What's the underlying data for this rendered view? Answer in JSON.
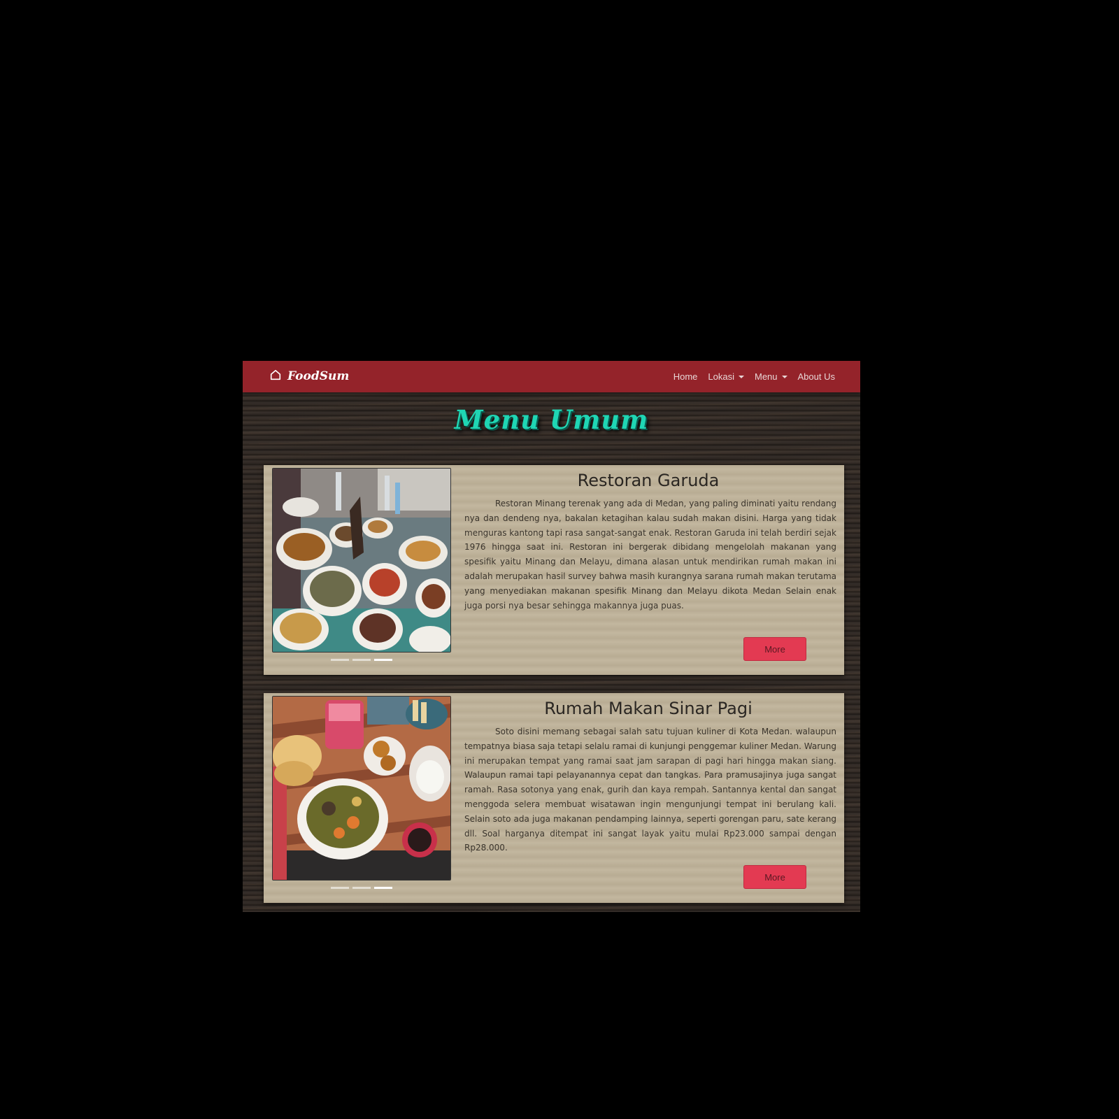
{
  "navbar": {
    "brand": "FoodSum",
    "brand_icon": "home-icon",
    "items": [
      {
        "label": "Home",
        "dropdown": false
      },
      {
        "label": "Lokasi",
        "dropdown": true
      },
      {
        "label": "Menu",
        "dropdown": true
      },
      {
        "label": "About Us",
        "dropdown": false
      }
    ]
  },
  "page": {
    "title": "Menu Umum"
  },
  "cards": [
    {
      "title": "Restoran Garuda",
      "text": "Restoran Minang terenak yang ada di Medan, yang paling diminati yaitu rendang nya dan dendeng nya, bakalan ketagihan kalau sudah makan disini. Harga yang tidak menguras kantong tapi rasa sangat-sangat enak. Restoran Garuda ini telah berdiri sejak 1976 hingga saat ini. Restoran ini bergerak dibidang mengelolah makanan yang spesifik yaitu Minang dan Melayu, dimana alasan untuk mendirikan rumah makan ini adalah merupakan hasil survey bahwa masih kurangnya sarana rumah makan terutama yang menyediakan makanan spesifik Minang dan Melayu dikota Medan Selain enak juga porsi nya besar sehingga makannya juga puas.",
      "button": "More"
    },
    {
      "title": "Rumah Makan Sinar Pagi",
      "text": "Soto disini memang sebagai salah satu tujuan kuliner di Kota Medan. walaupun tempatnya biasa saja tetapi selalu ramai di kunjungi penggemar kuliner Medan. Warung ini merupakan tempat yang ramai saat jam sarapan di pagi hari hingga makan siang. Walaupun ramai tapi pelayanannya cepat dan tangkas. Para pramusajinya juga sangat ramah. Rasa sotonya yang enak, gurih dan kaya rempah. Santannya kental dan sangat menggoda selera membuat wisatawan ingin mengunjungi tempat ini berulang kali. Selain soto ada juga makanan pendamping lainnya, seperti gorengan paru, sate kerang dll. Soal harganya ditempat ini sangat layak yaitu mulai Rp23.000 sampai dengan Rp28.000.",
      "button": "More"
    }
  ],
  "colors": {
    "navbar": "#94232a",
    "title": "#1fd6b4",
    "card": "#bfb39a",
    "button": "#e33a52"
  }
}
